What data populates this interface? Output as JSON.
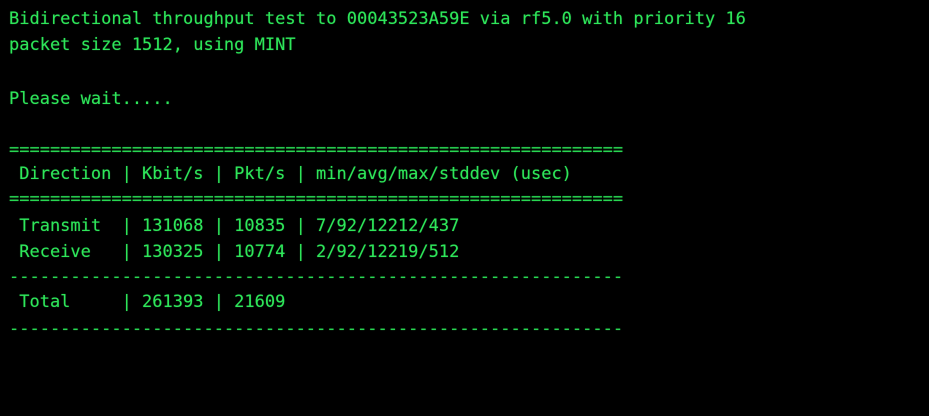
{
  "colors": {
    "background": "#000000",
    "text": "#2ee65a"
  },
  "header": {
    "line1": "Bidirectional throughput test to 00043523A59E via rf5.0 with priority 16",
    "line2": "packet size 1512, using MINT"
  },
  "status": "Please wait.....",
  "table": {
    "separator_double": "============================================================",
    "separator_single": "------------------------------------------------------------",
    "header_row": " Direction | Kbit/s | Pkt/s | min/avg/max/stddev (usec)",
    "rows": [
      " Transmit  | 131068 | 10835 | 7/92/12212/437",
      " Receive   | 130325 | 10774 | 2/92/12219/512"
    ],
    "total_row": " Total     | 261393 | 21609"
  }
}
